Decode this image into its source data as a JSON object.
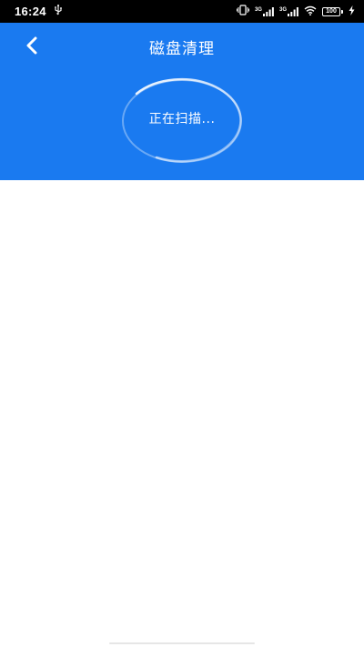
{
  "status_bar": {
    "time": "16:24",
    "network_1": "3G",
    "network_2": "3G",
    "battery": "100"
  },
  "header": {
    "title": "磁盘清理",
    "back_icon": "chevron-left-icon",
    "background_color": "#1a7af0"
  },
  "scan": {
    "status_text": "正在扫描..."
  }
}
